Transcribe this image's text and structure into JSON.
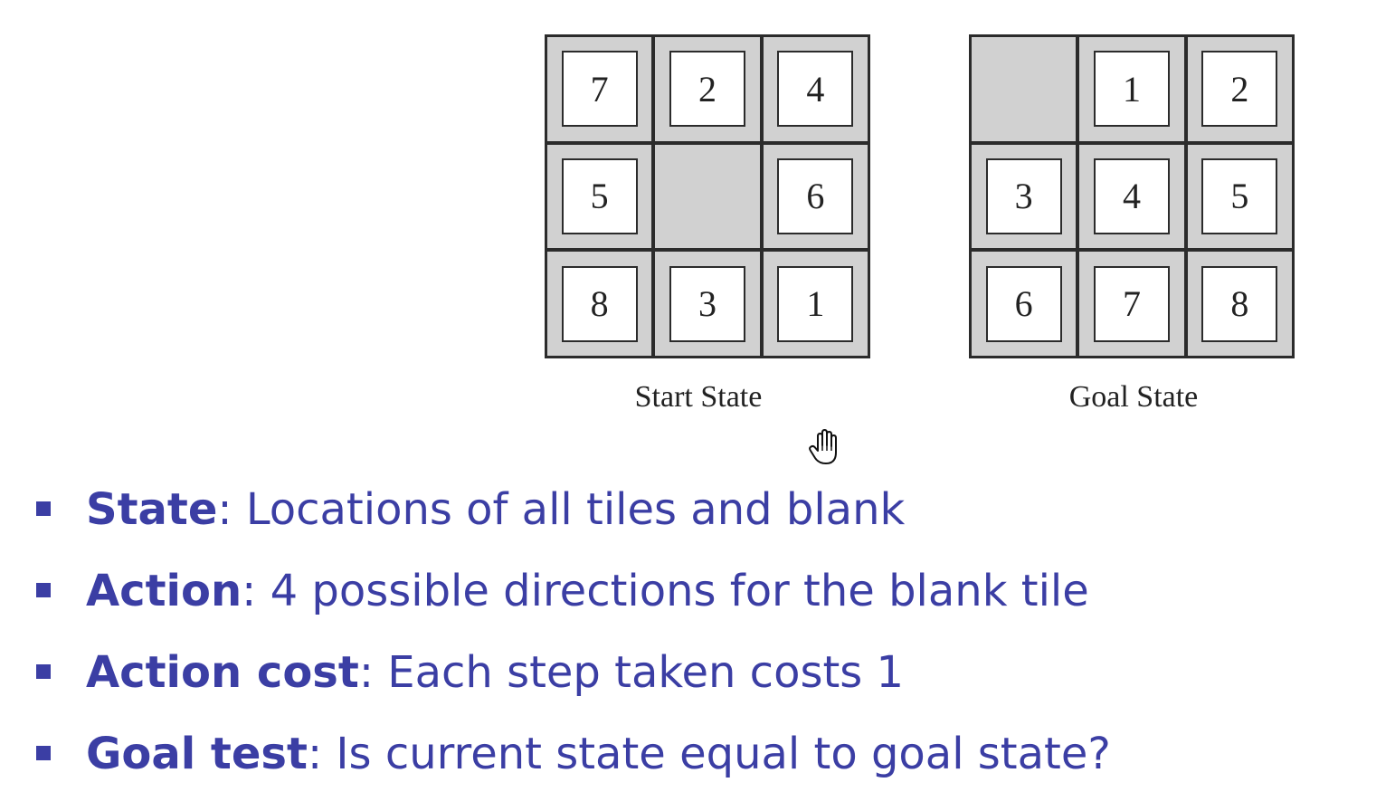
{
  "boards": {
    "start": {
      "caption": "Start State",
      "cells": [
        "7",
        "2",
        "4",
        "5",
        "",
        "6",
        "8",
        "3",
        "1"
      ]
    },
    "goal": {
      "caption": "Goal State",
      "cells": [
        "",
        "1",
        "2",
        "3",
        "4",
        "5",
        "6",
        "7",
        "8"
      ]
    }
  },
  "bullets": [
    {
      "term": "State",
      "sep": ": ",
      "text": "Locations of all tiles and blank"
    },
    {
      "term": "Action",
      "sep": ": ",
      "text": "4 possible directions for the blank tile"
    },
    {
      "term": "Action cost",
      "sep": ": ",
      "text": "Each step taken costs 1"
    },
    {
      "term": "Goal test",
      "sep": ": ",
      "text": "Is current state equal to goal state?"
    }
  ],
  "cursor_icon": "hand-pointer-icon",
  "colors": {
    "bullet_text": "#3b3ea4",
    "blank_cell": "#d1d1d1",
    "board_border": "#2b2b2b"
  }
}
